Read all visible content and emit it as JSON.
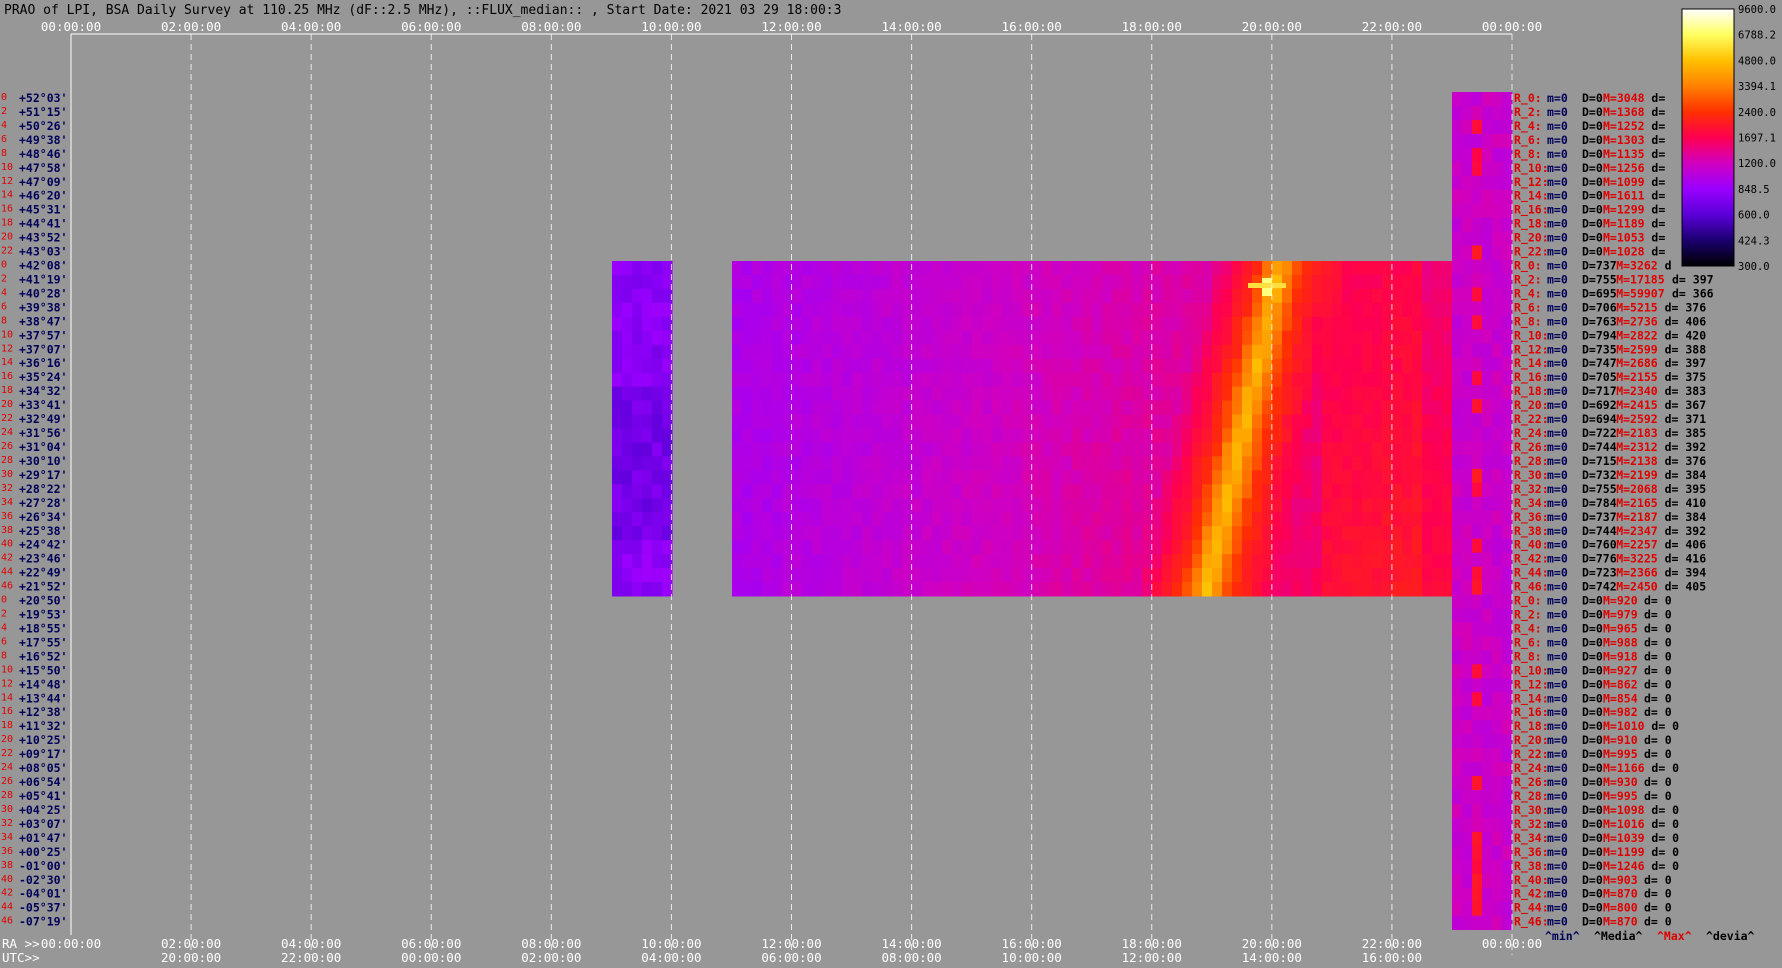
{
  "title": "PRAO of LPI, BSA Daily Survey at 110.25 MHz (dF::2.5 MHz), ::FLUX_median:: , Start Date: 2021 03 29 18:00:3",
  "chart_data": {
    "type": "heatmap",
    "title": "PRAO of LPI, BSA Daily Survey at 110.25 MHz (dF::2.5 MHz), ::FLUX_median:: , Start Date: 2021 03 29 18:00:3",
    "top_ticks": [
      "00:00:00",
      "02:00:00",
      "04:00:00",
      "06:00:00",
      "08:00:00",
      "10:00:00",
      "12:00:00",
      "14:00:00",
      "16:00:00",
      "18:00:00",
      "20:00:00",
      "22:00:00",
      "00:00:00"
    ],
    "bottom_ra_prefix": "RA >>",
    "bottom_ra_ticks": [
      "00:00:00",
      "02:00:00",
      "04:00:00",
      "06:00:00",
      "08:00:00",
      "10:00:00",
      "12:00:00",
      "14:00:00",
      "16:00:00",
      "18:00:00",
      "20:00:00",
      "22:00:00",
      "00:00:00"
    ],
    "bottom_utc_prefix": "UTC>>",
    "bottom_utc_ticks": [
      "",
      "20:00:00",
      "22:00:00",
      "00:00:00",
      "02:00:00",
      "04:00:00",
      "06:00:00",
      "08:00:00",
      "10:00:00",
      "12:00:00",
      "14:00:00",
      "16:00:00"
    ],
    "declinations": [
      "+52°03'",
      "+51°15'",
      "+50°26'",
      "+49°38'",
      "+48°46'",
      "+47°58'",
      "+47°09'",
      "+46°20'",
      "+45°31'",
      "+44°41'",
      "+43°52'",
      "+43°03'",
      "+42°08'",
      "+41°19'",
      "+40°28'",
      "+39°38'",
      "+38°47'",
      "+37°57'",
      "+37°07'",
      "+36°16'",
      "+35°24'",
      "+34°32'",
      "+33°41'",
      "+32°49'",
      "+31°56'",
      "+31°04'",
      "+30°10'",
      "+29°17'",
      "+28°22'",
      "+27°28'",
      "+26°34'",
      "+25°38'",
      "+24°42'",
      "+23°46'",
      "+22°49'",
      "+21°52'",
      "+20°50'",
      "+19°53'",
      "+18°55'",
      "+17°55'",
      "+16°52'",
      "+15°50'",
      "+14°48'",
      "+13°44'",
      "+12°38'",
      "+11°32'",
      "+10°25'",
      "+09°17'",
      "+08°05'",
      "+06°54'",
      "+05°41'",
      "+04°25'",
      "+03°07'",
      "+01°47'",
      "+00°25'",
      "-01°00'",
      "-02°30'",
      "-04°01'",
      "-05°37'",
      "-07°19'"
    ],
    "row_index_labels": [
      "0",
      "2",
      "4",
      "6",
      "8",
      "10",
      "12",
      "14",
      "16",
      "18",
      "20",
      "22",
      "0",
      "2",
      "4",
      "6",
      "8",
      "10",
      "12",
      "14",
      "16",
      "18",
      "20",
      "22",
      "24",
      "26",
      "28",
      "30",
      "32",
      "34",
      "36",
      "38",
      "40",
      "42",
      "44",
      "46",
      "0",
      "2",
      "4",
      "6",
      "8",
      "10",
      "12",
      "14",
      "16",
      "18",
      "20",
      "22",
      "24",
      "26",
      "28",
      "30",
      "32",
      "34",
      "36",
      "38",
      "40",
      "42",
      "44",
      "46"
    ],
    "stats_rows": [
      {
        "r": "R_0:",
        "m": "m=0",
        "D": "D=0",
        "M": "M=3048",
        "d": "d="
      },
      {
        "r": "R_2:",
        "m": "m=0",
        "D": "D=0",
        "M": "M=1368",
        "d": "d="
      },
      {
        "r": "R_4:",
        "m": "m=0",
        "D": "D=0",
        "M": "M=1252",
        "d": "d="
      },
      {
        "r": "R_6:",
        "m": "m=0",
        "D": "D=0",
        "M": "M=1303",
        "d": "d="
      },
      {
        "r": "R_8:",
        "m": "m=0",
        "D": "D=0",
        "M": "M=1135",
        "d": "d="
      },
      {
        "r": "R_10:",
        "m": "m=0",
        "D": "D=0",
        "M": "M=1256",
        "d": "d="
      },
      {
        "r": "R_12:",
        "m": "m=0",
        "D": "D=0",
        "M": "M=1099",
        "d": "d="
      },
      {
        "r": "R_14:",
        "m": "m=0",
        "D": "D=0",
        "M": "M=1611",
        "d": "d="
      },
      {
        "r": "R_16:",
        "m": "m=0",
        "D": "D=0",
        "M": "M=1299",
        "d": "d="
      },
      {
        "r": "R_18:",
        "m": "m=0",
        "D": "D=0",
        "M": "M=1189",
        "d": "d="
      },
      {
        "r": "R_20:",
        "m": "m=0",
        "D": "D=0",
        "M": "M=1053",
        "d": "d="
      },
      {
        "r": "R_22:",
        "m": "m=0",
        "D": "D=0",
        "M": "M=1028",
        "d": "d="
      },
      {
        "r": "R_0:",
        "m": "m=0",
        "D": "D=737",
        "M": "M=3262",
        "d": "d"
      },
      {
        "r": "R_2:",
        "m": "m=0",
        "D": "D=755",
        "M": "M=17185",
        "d": "d= 397"
      },
      {
        "r": "R_4:",
        "m": "m=0",
        "D": "D=695",
        "M": "M=59907",
        "d": "d= 366"
      },
      {
        "r": "R_6:",
        "m": "m=0",
        "D": "D=706",
        "M": "M=5215",
        "d": "d= 376"
      },
      {
        "r": "R_8:",
        "m": "m=0",
        "D": "D=763",
        "M": "M=2736",
        "d": "d= 406"
      },
      {
        "r": "R_10:",
        "m": "m=0",
        "D": "D=794",
        "M": "M=2822",
        "d": "d= 420"
      },
      {
        "r": "R_12:",
        "m": "m=0",
        "D": "D=735",
        "M": "M=2599",
        "d": "d= 388"
      },
      {
        "r": "R_14:",
        "m": "m=0",
        "D": "D=747",
        "M": "M=2686",
        "d": "d= 397"
      },
      {
        "r": "R_16:",
        "m": "m=0",
        "D": "D=705",
        "M": "M=2155",
        "d": "d= 375"
      },
      {
        "r": "R_18:",
        "m": "m=0",
        "D": "D=717",
        "M": "M=2340",
        "d": "d= 383"
      },
      {
        "r": "R_20:",
        "m": "m=0",
        "D": "D=692",
        "M": "M=2415",
        "d": "d= 367"
      },
      {
        "r": "R_22:",
        "m": "m=0",
        "D": "D=694",
        "M": "M=2592",
        "d": "d= 371"
      },
      {
        "r": "R_24:",
        "m": "m=0",
        "D": "D=722",
        "M": "M=2183",
        "d": "d= 385"
      },
      {
        "r": "R_26:",
        "m": "m=0",
        "D": "D=744",
        "M": "M=2312",
        "d": "d= 392"
      },
      {
        "r": "R_28:",
        "m": "m=0",
        "D": "D=715",
        "M": "M=2138",
        "d": "d= 376"
      },
      {
        "r": "R_30:",
        "m": "m=0",
        "D": "D=732",
        "M": "M=2199",
        "d": "d= 384"
      },
      {
        "r": "R_32:",
        "m": "m=0",
        "D": "D=755",
        "M": "M=2068",
        "d": "d= 395"
      },
      {
        "r": "R_34:",
        "m": "m=0",
        "D": "D=784",
        "M": "M=2165",
        "d": "d= 410"
      },
      {
        "r": "R_36:",
        "m": "m=0",
        "D": "D=737",
        "M": "M=2187",
        "d": "d= 384"
      },
      {
        "r": "R_38:",
        "m": "m=0",
        "D": "D=744",
        "M": "M=2347",
        "d": "d= 392"
      },
      {
        "r": "R_40:",
        "m": "m=0",
        "D": "D=760",
        "M": "M=2257",
        "d": "d= 406"
      },
      {
        "r": "R_42:",
        "m": "m=0",
        "D": "D=776",
        "M": "M=3225",
        "d": "d= 416"
      },
      {
        "r": "R_44:",
        "m": "m=0",
        "D": "D=723",
        "M": "M=2366",
        "d": "d= 394"
      },
      {
        "r": "R_46:",
        "m": "m=0",
        "D": "D=742",
        "M": "M=2450",
        "d": "d= 405"
      },
      {
        "r": "R_0:",
        "m": "m=0",
        "D": "D=0",
        "M": "M=920",
        "d": "d= 0"
      },
      {
        "r": "R_2:",
        "m": "m=0",
        "D": "D=0",
        "M": "M=979",
        "d": "d= 0"
      },
      {
        "r": "R_4:",
        "m": "m=0",
        "D": "D=0",
        "M": "M=965",
        "d": "d= 0"
      },
      {
        "r": "R_6:",
        "m": "m=0",
        "D": "D=0",
        "M": "M=988",
        "d": "d= 0"
      },
      {
        "r": "R_8:",
        "m": "m=0",
        "D": "D=0",
        "M": "M=918",
        "d": "d= 0"
      },
      {
        "r": "R_10:",
        "m": "m=0",
        "D": "D=0",
        "M": "M=927",
        "d": "d= 0"
      },
      {
        "r": "R_12:",
        "m": "m=0",
        "D": "D=0",
        "M": "M=862",
        "d": "d= 0"
      },
      {
        "r": "R_14:",
        "m": "m=0",
        "D": "D=0",
        "M": "M=854",
        "d": "d= 0"
      },
      {
        "r": "R_16:",
        "m": "m=0",
        "D": "D=0",
        "M": "M=982",
        "d": "d= 0"
      },
      {
        "r": "R_18:",
        "m": "m=0",
        "D": "D=0",
        "M": "M=1010",
        "d": "d= 0"
      },
      {
        "r": "R_20:",
        "m": "m=0",
        "D": "D=0",
        "M": "M=910",
        "d": "d= 0"
      },
      {
        "r": "R_22:",
        "m": "m=0",
        "D": "D=0",
        "M": "M=995",
        "d": "d= 0"
      },
      {
        "r": "R_24:",
        "m": "m=0",
        "D": "D=0",
        "M": "M=1166",
        "d": "d= 0"
      },
      {
        "r": "R_26:",
        "m": "m=0",
        "D": "D=0",
        "M": "M=930",
        "d": "d= 0"
      },
      {
        "r": "R_28:",
        "m": "m=0",
        "D": "D=0",
        "M": "M=995",
        "d": "d= 0"
      },
      {
        "r": "R_30:",
        "m": "m=0",
        "D": "D=0",
        "M": "M=1098",
        "d": "d= 0"
      },
      {
        "r": "R_32:",
        "m": "m=0",
        "D": "D=0",
        "M": "M=1016",
        "d": "d= 0"
      },
      {
        "r": "R_34:",
        "m": "m=0",
        "D": "D=0",
        "M": "M=1039",
        "d": "d= 0"
      },
      {
        "r": "R_36:",
        "m": "m=0",
        "D": "D=0",
        "M": "M=1199",
        "d": "d= 0"
      },
      {
        "r": "R_38:",
        "m": "m=0",
        "D": "D=0",
        "M": "M=1246",
        "d": "d= 0"
      },
      {
        "r": "R_40:",
        "m": "m=0",
        "D": "D=0",
        "M": "M=903",
        "d": "d= 0"
      },
      {
        "r": "R_42:",
        "m": "m=0",
        "D": "D=0",
        "M": "M=870",
        "d": "d= 0"
      },
      {
        "r": "R_44:",
        "m": "m=0",
        "D": "D=0",
        "M": "M=800",
        "d": "d= 0"
      },
      {
        "r": "R_46:",
        "m": "m=0",
        "D": "D=0",
        "M": "M=870",
        "d": "d= 0"
      }
    ],
    "legend_keys": {
      "min": "^min^",
      "median": "^Media^",
      "max": "^Max^",
      "dev": "^devia^"
    },
    "colorbar": {
      "ticks": [
        "9600.0",
        "6788.2",
        "4800.0",
        "3394.1",
        "2400.0",
        "1697.1",
        "1200.0",
        "848.5",
        "600.0",
        "424.3",
        "300.0"
      ],
      "colors": [
        "#000000",
        "#1a0070",
        "#5a00d8",
        "#9a00ff",
        "#d000c0",
        "#ff0050",
        "#ff3000",
        "#ff8000",
        "#ffc000",
        "#ffff60",
        "#ffffff"
      ]
    },
    "background_color": "#979797",
    "grid": "dashed vertical, white"
  }
}
